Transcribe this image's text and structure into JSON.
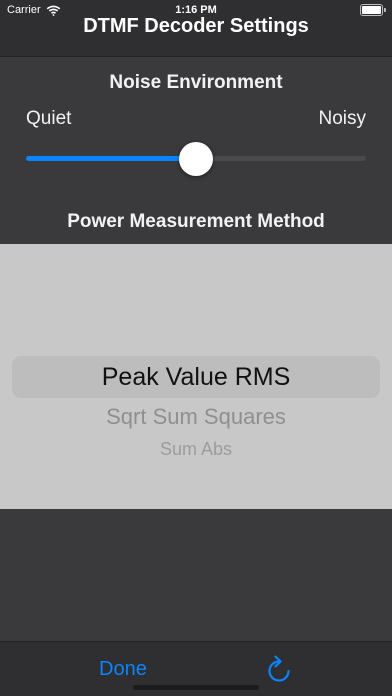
{
  "status_bar": {
    "carrier": "Carrier",
    "time": "1:16 PM",
    "icons": [
      "wifi-icon",
      "battery-icon"
    ]
  },
  "nav": {
    "title": "DTMF Decoder Settings"
  },
  "noise": {
    "title": "Noise Environment",
    "min_label": "Quiet",
    "max_label": "Noisy",
    "value": 0.5
  },
  "power": {
    "title": "Power Measurement Method",
    "options": [
      "Peak Value RMS",
      "Sqrt Sum Squares",
      "Sum Abs"
    ],
    "selected": "Peak Value RMS"
  },
  "toolbar": {
    "done_label": "Done",
    "refresh_icon": "refresh-icon"
  },
  "colors": {
    "accent": "#0a84ff",
    "background": "#3a3a3c",
    "picker_background": "#c8c8c8"
  }
}
